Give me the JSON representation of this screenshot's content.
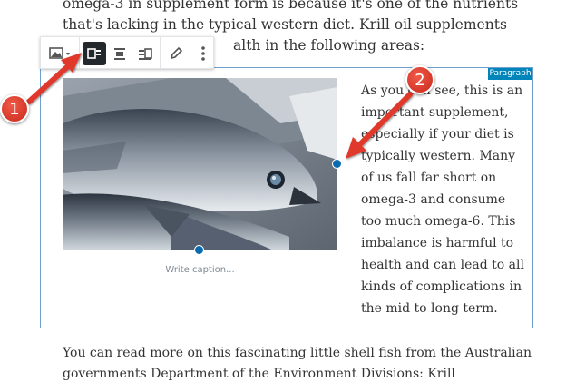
{
  "intro": {
    "line1": "omega-3 in supplement form is because it's one of the nutrients",
    "line2": "that's lacking in the typical western diet. Krill oil supplements",
    "line3": "alth in the following areas:"
  },
  "toolbar": {
    "buttons": [
      "image-type-icon",
      "media-left-icon",
      "media-center-icon",
      "media-right-icon",
      "pencil-icon",
      "more-options-icon"
    ]
  },
  "block": {
    "badge": "Paragraph",
    "caption_placeholder": "Write caption...",
    "side_text": [
      "As you can see, this is an",
      "important supplement,",
      "especially if your diet is",
      "typically western. Many",
      "of us fall far short on",
      "omega-3 and consume",
      "too much omega-6. This",
      "imbalance is harmful to",
      "health and can lead to all",
      "kinds of complications in",
      "the mid to long term."
    ]
  },
  "footer_text": {
    "line1": "You can read more on this fascinating little shell fish from the Australian",
    "line2": "governments Department of the Environment Divisions: Krill"
  },
  "annotations": {
    "callout1": "1",
    "callout2": "2"
  },
  "colors": {
    "accent": "#0085ba",
    "arrow": "#e0392b",
    "selection_border": "#6fa1cf"
  }
}
